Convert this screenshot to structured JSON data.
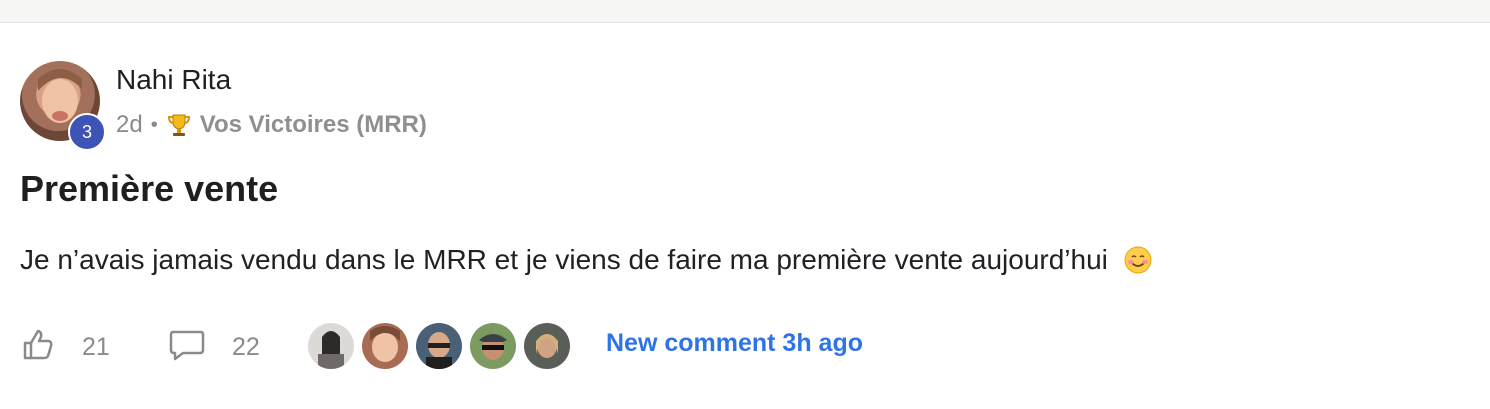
{
  "post": {
    "author": "Nahi Rita",
    "level": "3",
    "time": "2d",
    "separator": "•",
    "category": "Vos Victoires (MRR)",
    "title": "Première vente",
    "body": "Je n’avais jamais vendu dans le MRR et je viens de faire ma première vente aujourd’hui",
    "likes": "21",
    "comments": "22",
    "new_comment": "New comment 3h ago"
  },
  "icons": {
    "category": "trophy-icon",
    "body_emoji": "smiling-face-icon",
    "like": "thumbs-up-icon",
    "comment": "speech-bubble-icon"
  },
  "colors": {
    "level_badge": "#3d53b5",
    "link": "#2f74e6",
    "muted": "#8a8a8a"
  }
}
